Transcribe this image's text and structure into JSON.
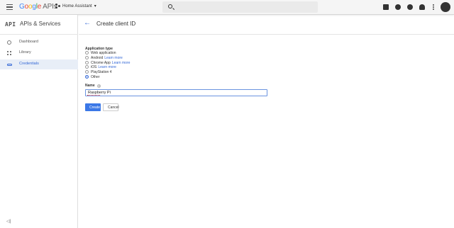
{
  "header": {
    "logo": {
      "g1": "G",
      "g2": "o",
      "g3": "o",
      "g4": "g",
      "g5": "l",
      "g6": "e",
      "apis": "APIs"
    },
    "project_name": "Home Assistant",
    "project_caret": "▾",
    "search_placeholder": "",
    "icons": [
      "menu-icon",
      "project-icon",
      "search-icon",
      "gift-icon",
      "notifications-icon",
      "help-icon",
      "alerts-icon",
      "more-icon",
      "account-avatar"
    ]
  },
  "sidebar": {
    "api_badge": "API",
    "title": "APIs & Services",
    "items": [
      {
        "label": "Dashboard",
        "icon": "dashboard-icon",
        "active": false
      },
      {
        "label": "Library",
        "icon": "library-icon",
        "active": false
      },
      {
        "label": "Credentials",
        "icon": "key-icon",
        "active": true
      }
    ],
    "collapse_glyph": "◁|"
  },
  "main": {
    "back_glyph": "←",
    "title": "Create client ID",
    "application_type_label": "Application type",
    "options": [
      {
        "label": "Web application",
        "link": "",
        "selected": false
      },
      {
        "label": "Android",
        "link": "Learn more",
        "selected": false
      },
      {
        "label": "Chrome App",
        "link": "Learn more",
        "selected": false
      },
      {
        "label": "iOS",
        "link": "Learn more",
        "selected": false
      },
      {
        "label": "PlayStation 4",
        "link": "",
        "selected": false
      },
      {
        "label": "Other",
        "link": "",
        "selected": true
      }
    ],
    "name_label": "Name",
    "help_glyph": "?",
    "name_value": "Raspberry Pi",
    "create_label": "Create",
    "cancel_label": "Cancel"
  },
  "colors": {
    "accent": "#3367d6",
    "button": "#3b78e7",
    "active_bg": "#e8eef7"
  }
}
